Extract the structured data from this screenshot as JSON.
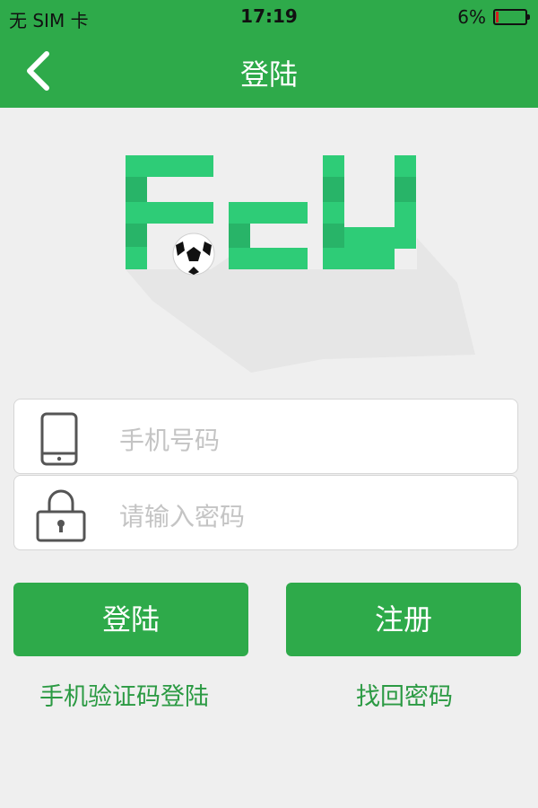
{
  "status_bar": {
    "carrier": "无 SIM 卡",
    "time": "17:19",
    "battery_percent": "6%",
    "battery_level": 0.06
  },
  "nav": {
    "title": "登陆",
    "back_icon": "chevron-left-icon"
  },
  "logo": {
    "text": "FCY",
    "color": "#2ecc77"
  },
  "form": {
    "phone_placeholder": "手机号码",
    "phone_icon": "phone-icon",
    "password_placeholder": "请输入密码",
    "password_icon": "lock-icon"
  },
  "actions": {
    "login_label": "登陆",
    "register_label": "注册",
    "sms_login_link": "手机验证码登陆",
    "forgot_password_link": "找回密码"
  },
  "colors": {
    "brand_green": "#2eaa4a",
    "link_green": "#2b9a43",
    "battery_low": "#d41f1f"
  }
}
